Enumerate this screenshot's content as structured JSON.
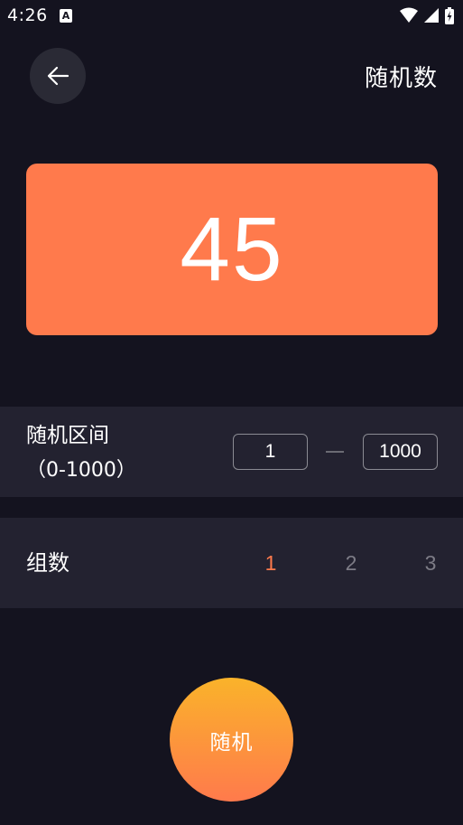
{
  "status_bar": {
    "time": "4:26",
    "notification_icon": "A"
  },
  "header": {
    "back_icon": "arrow-left-icon",
    "title": "随机数"
  },
  "result": {
    "value": "45"
  },
  "range": {
    "label": "随机区间",
    "hint": "（0-1000）",
    "min_value": "1",
    "max_value": "1000"
  },
  "groups": {
    "label": "组数",
    "options": [
      "1",
      "2",
      "3"
    ],
    "selected": "1"
  },
  "action": {
    "random_label": "随机"
  },
  "colors": {
    "background": "#14131f",
    "row_background": "#232230",
    "accent": "#ff7a4c",
    "button_gradient_top": "#fab32a",
    "muted_text": "#7d7c86"
  }
}
